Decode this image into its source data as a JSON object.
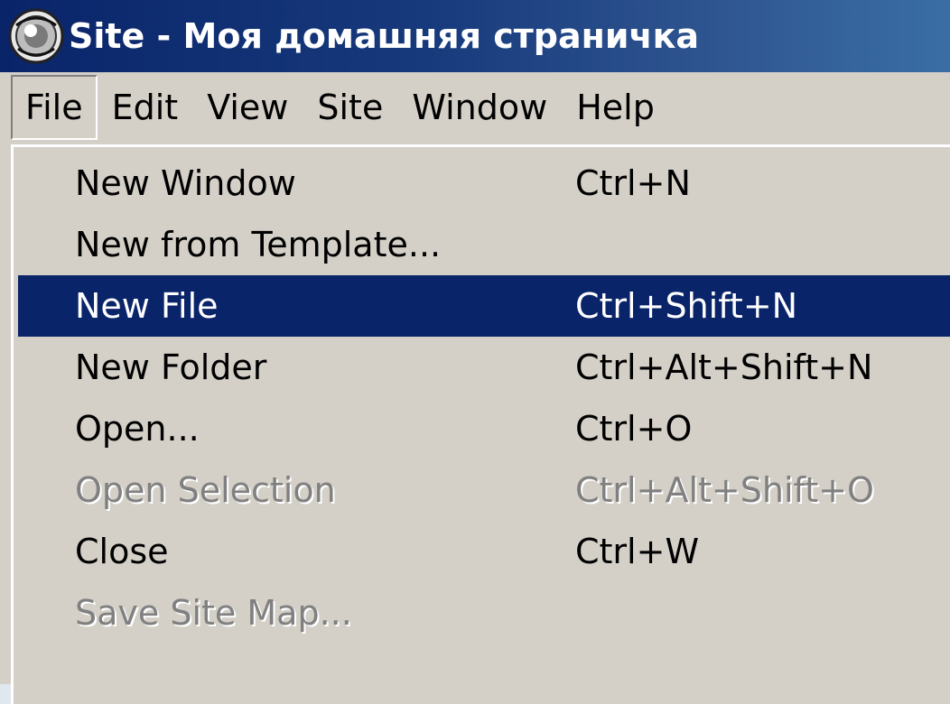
{
  "window": {
    "title": "Site - Моя домашняя страничка",
    "app_icon": "dreamweaver-icon"
  },
  "menu_bar": {
    "items": [
      {
        "label": "File",
        "active": true
      },
      {
        "label": "Edit",
        "active": false
      },
      {
        "label": "View",
        "active": false
      },
      {
        "label": "Site",
        "active": false
      },
      {
        "label": "Window",
        "active": false
      },
      {
        "label": "Help",
        "active": false
      }
    ]
  },
  "file_menu": {
    "items": [
      {
        "label": "New Window",
        "shortcut": "Ctrl+N",
        "state": "enabled"
      },
      {
        "label": "New from Template...",
        "shortcut": "",
        "state": "enabled"
      },
      {
        "label": "New File",
        "shortcut": "Ctrl+Shift+N",
        "state": "highlighted"
      },
      {
        "label": "New Folder",
        "shortcut": "Ctrl+Alt+Shift+N",
        "state": "enabled"
      },
      {
        "label": "Open...",
        "shortcut": "Ctrl+O",
        "state": "enabled"
      },
      {
        "label": "Open Selection",
        "shortcut": "Ctrl+Alt+Shift+O",
        "state": "disabled"
      },
      {
        "label": "Close",
        "shortcut": "Ctrl+W",
        "state": "enabled"
      },
      {
        "label": "Save Site Map...",
        "shortcut": "",
        "state": "disabled"
      }
    ]
  },
  "colors": {
    "title_bar_start": "#0a246a",
    "title_bar_end": "#3a6ea5",
    "menu_background": "#d4d0c8",
    "highlight": "#0a246a",
    "disabled_text": "#808080"
  }
}
